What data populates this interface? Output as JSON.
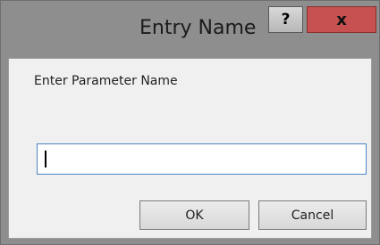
{
  "window": {
    "title": "Entry Name",
    "help_label": "?",
    "close_label": "x"
  },
  "dialog": {
    "prompt": "Enter Parameter Name",
    "input_value": "",
    "ok_label": "OK",
    "cancel_label": "Cancel"
  },
  "colors": {
    "frame": "#8e8e8e",
    "client": "#f0f0f0",
    "close_button": "#c75050",
    "input_border": "#4d84c4"
  }
}
